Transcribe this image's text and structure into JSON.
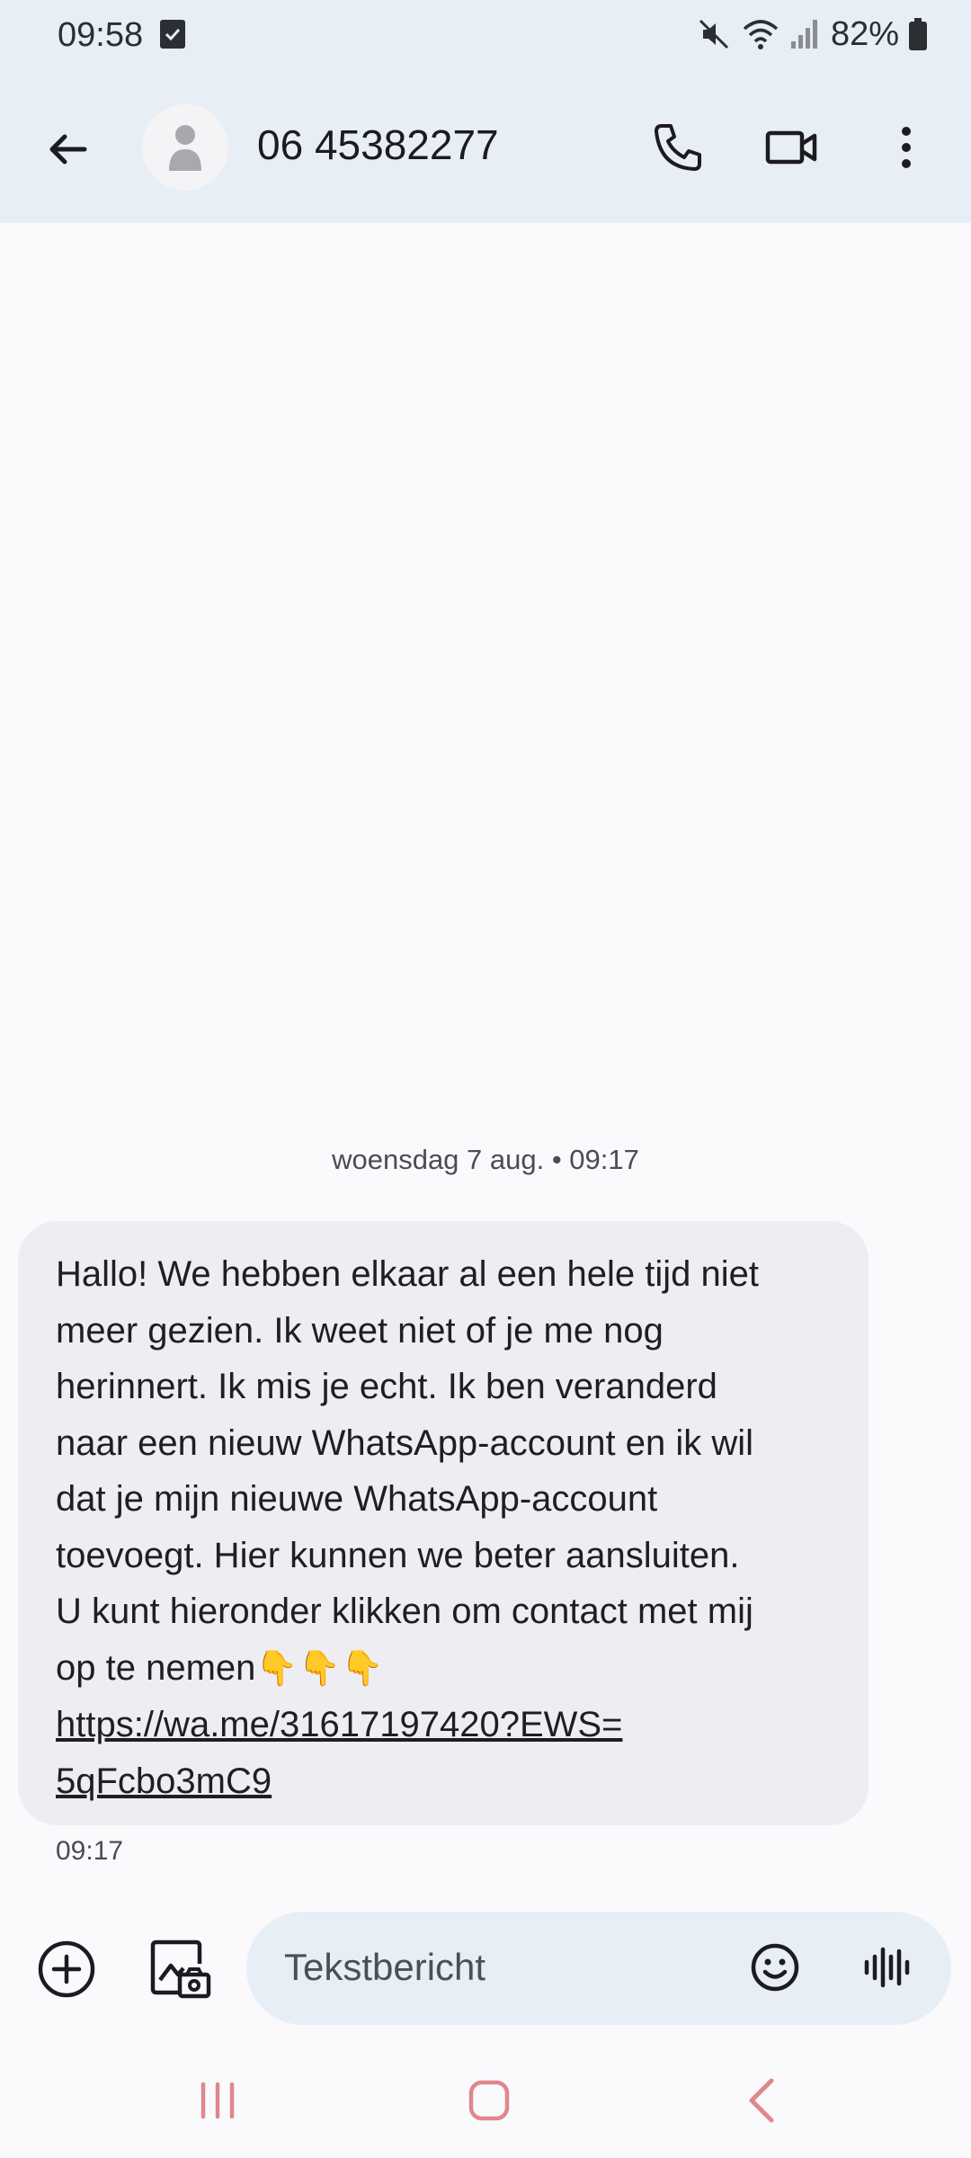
{
  "status_bar": {
    "time": "09:58",
    "battery": "82%"
  },
  "header": {
    "contact": "06 45382277"
  },
  "conversation": {
    "date_separator": "woensdag 7 aug. • 09:17",
    "message": {
      "text": "Hallo! We hebben elkaar al een hele tijd niet\nmeer gezien. Ik weet niet of je me nog\nherinnert. Ik mis je echt. Ik ben veranderd\nnaar een nieuw WhatsApp-account en ik wil\ndat je mijn nieuwe WhatsApp-account\ntoevoegt. Hier kunnen we beter aansluiten.\nU kunt hieronder klikken om contact met mij\nop te nemen",
      "emojis": "👇👇👇",
      "link_line1": "https://wa.me/31617197420?EWS=",
      "link_line2": "5qFcbo3mC9",
      "time": "09:17"
    }
  },
  "composer": {
    "placeholder": "Tekstbericht"
  }
}
